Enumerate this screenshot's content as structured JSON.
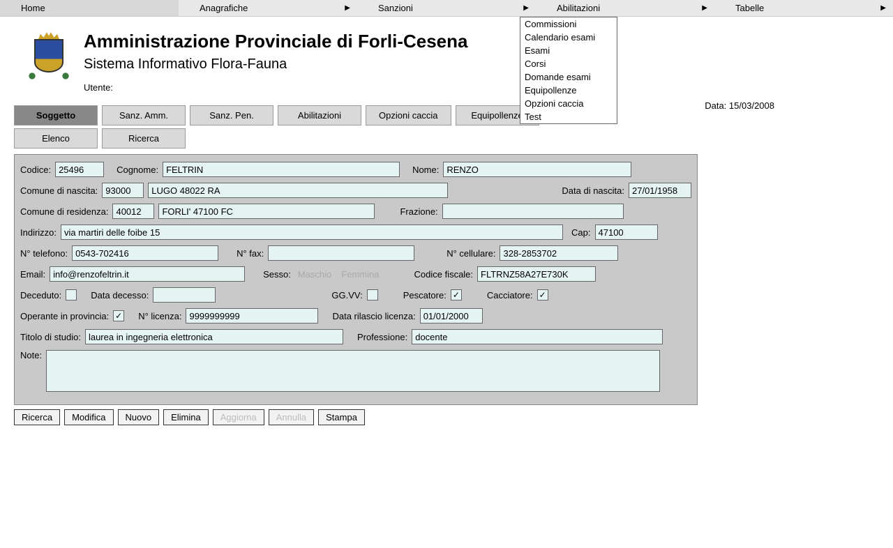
{
  "menu": {
    "items": [
      "Home",
      "Anagrafiche",
      "Sanzioni",
      "Abilitazioni",
      "Tabelle"
    ],
    "dropdown": [
      "Commissioni",
      "Calendario esami",
      "Esami",
      "Corsi",
      "Domande esami",
      "Equipollenze",
      "Opzioni caccia",
      "Test"
    ]
  },
  "header": {
    "title": "Amministrazione Provinciale di Forli-Cesena",
    "subtitle": "Sistema Informativo Flora-Fauna",
    "user_label": "Utente:",
    "date_label": "Data:",
    "date_value": "15/03/2008"
  },
  "tabs": {
    "row1": [
      "Soggetto",
      "Sanz. Amm.",
      "Sanz. Pen.",
      "Abilitazioni",
      "Opzioni caccia",
      "Equipollenze"
    ],
    "row2": [
      "Elenco",
      "Ricerca"
    ]
  },
  "form": {
    "codice": {
      "label": "Codice:",
      "value": "25496"
    },
    "cognome": {
      "label": "Cognome:",
      "value": "FELTRIN"
    },
    "nome": {
      "label": "Nome:",
      "value": "RENZO"
    },
    "comune_nascita": {
      "label": "Comune di nascita:",
      "code": "93000",
      "text": "LUGO 48022 RA"
    },
    "data_nascita": {
      "label": "Data di nascita:",
      "value": "27/01/1958"
    },
    "comune_residenza": {
      "label": "Comune di residenza:",
      "code": "40012",
      "text": "FORLI' 47100 FC"
    },
    "frazione": {
      "label": "Frazione:",
      "value": ""
    },
    "indirizzo": {
      "label": "Indirizzo:",
      "value": "via martiri delle foibe 15"
    },
    "cap": {
      "label": "Cap:",
      "value": "47100"
    },
    "telefono": {
      "label": "N° telefono:",
      "value": "0543-702416"
    },
    "fax": {
      "label": "N° fax:",
      "value": ""
    },
    "cellulare": {
      "label": "N° cellulare:",
      "value": "328-2853702"
    },
    "email": {
      "label": "Email:",
      "value": "info@renzofeltrin.it"
    },
    "sesso": {
      "label": "Sesso:",
      "maschio": "Maschio",
      "femmina": "Femmina"
    },
    "codice_fiscale": {
      "label": "Codice fiscale:",
      "value": "FLTRNZ58A27E730K"
    },
    "deceduto": {
      "label": "Deceduto:",
      "checked": false
    },
    "data_decesso": {
      "label": "Data decesso:",
      "value": ""
    },
    "ggvv": {
      "label": "GG.VV:",
      "checked": false
    },
    "pescatore": {
      "label": "Pescatore:",
      "checked": true
    },
    "cacciatore": {
      "label": "Cacciatore:",
      "checked": true
    },
    "operante": {
      "label": "Operante in provincia:",
      "checked": true
    },
    "licenza": {
      "label": "N° licenza:",
      "value": "9999999999"
    },
    "data_licenza": {
      "label": "Data rilascio licenza:",
      "value": "01/01/2000"
    },
    "titolo": {
      "label": "Titolo di studio:",
      "value": "laurea in ingegneria elettronica"
    },
    "professione": {
      "label": "Professione:",
      "value": "docente"
    },
    "note": {
      "label": "Note:",
      "value": ""
    }
  },
  "buttons": {
    "ricerca": "Ricerca",
    "modifica": "Modifica",
    "nuovo": "Nuovo",
    "elimina": "Elimina",
    "aggiorna": "Aggiorna",
    "annulla": "Annulla",
    "stampa": "Stampa"
  },
  "check_mark": "✓"
}
